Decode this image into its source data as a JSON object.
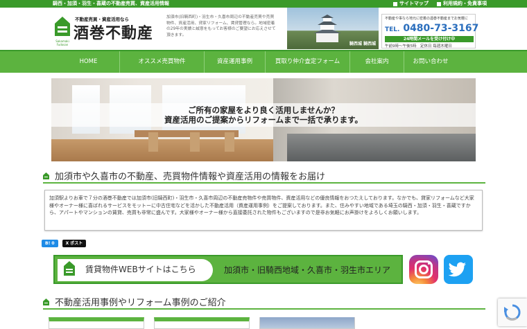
{
  "topbar": {
    "tagline": "騎西・加須・羽生・喜蔵の不動産売買、資産活用情報",
    "links": [
      "サイトマップ",
      "利用規約・免責事項"
    ]
  },
  "header": {
    "logo_small": "不動産売買・資産活用なら",
    "logo_big": "酒巻不動産",
    "logo_sub": "Sakamaki Fudosan",
    "intro": "加須市(旧騎西町)・羽生市・久喜市周辺の不動産売買や売買物件、資産活用、貸家リフォーム、賃貸管理なら。地域密着の29年の実績と誠意をもってお客様のご要望にお応えさせて頂きます。",
    "photo_caption": "騎西城 騎西城",
    "contact": {
      "line1": "不動産や事なら地元に密着の酒巻不動産までお気軽に",
      "tel_label": "TEL.",
      "tel": "0480-73-3167",
      "band": "24時間メールを受け付け中",
      "hours": "午前9時～午後5時　定休日 毎週木曜日"
    }
  },
  "nav": {
    "items": [
      "HOME",
      "オススメ売買物件",
      "資産運用事例",
      "買取り仲介査定フォーム",
      "会社案内",
      "お問い合わせ"
    ]
  },
  "hero": {
    "line1": "ご所有の家屋をより良く活用しませんか？",
    "line2": "資産活用のご提案からリフォームまで一括で承ります。"
  },
  "section1": {
    "title": "加須市や久喜市の不動産、売買物件情報や資産活用の情報をお届け",
    "body": "加須駅よりお車で７分の酒巻不動産では加須市(旧騎西町)・羽生市・久喜市周辺の不動産売物件や売買物件、資産活用などの優良情報をおつたえしております。なかでも、貸家リフォームなど大家様やオーナー様に喜ばれるサービスをモットーに中古住宅などを活かした不動産活用（資産運用事例）をご提案しております。また、住みやすい地域である埼玉の騎西・加須・羽生・喜蔵ですから、アパートやマンションの賃貸、売買も非常に盛んです。大家様やオーナー様から直接委託された物件もございますので是非お気軽にお声掛けをよろしくお願いします。"
  },
  "share": {
    "hatena": "B! 0",
    "x_post": "X ポスト"
  },
  "banner": {
    "title": "賃貸物件WEBサイトはこちら",
    "areas": "加須市・旧騎西地域・久喜市・羽生市エリア"
  },
  "section2": {
    "title": "不動産活用事例やリフォーム事例のご紹介"
  },
  "colors": {
    "brand_green": "#5cb33f",
    "dark_green": "#3a9a2a",
    "tel_blue": "#2a6ebd",
    "twitter_blue": "#1da1f2"
  }
}
